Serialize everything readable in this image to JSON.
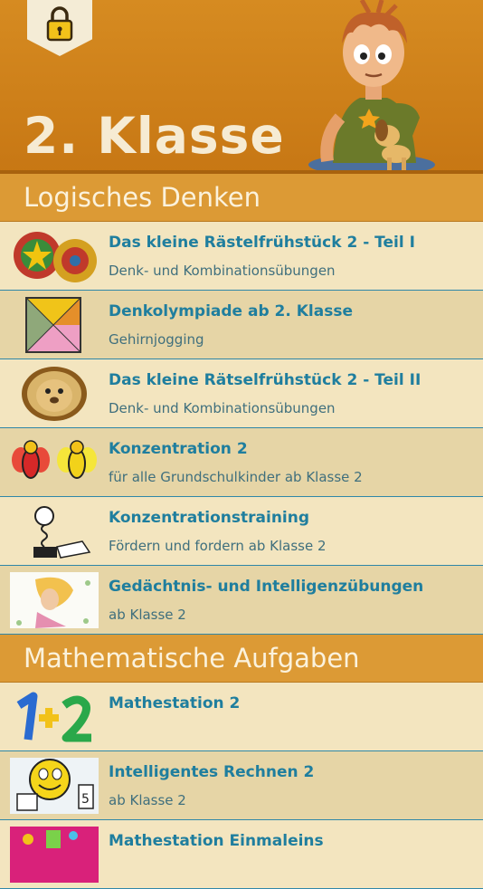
{
  "header": {
    "title": "2. Klasse",
    "lock_icon": "lock-icon"
  },
  "sections": {
    "logic": {
      "title": "Logisches Denken",
      "items": [
        {
          "title": "Das kleine Rästelfrühstück 2 - Teil I",
          "subtitle": "Denk- und Kombinationsübungen"
        },
        {
          "title": "Denkolympiade ab 2. Klasse",
          "subtitle": "Gehirnjogging"
        },
        {
          "title": "Das kleine Rätselfrühstück 2 - Teil II",
          "subtitle": "Denk- und Kombinationsübungen"
        },
        {
          "title": "Konzentration 2",
          "subtitle": "für alle Grundschulkinder ab Klasse 2"
        },
        {
          "title": "Konzentrationstraining",
          "subtitle": "Fördern und fordern ab Klasse 2"
        },
        {
          "title": "Gedächtnis- und Intelligenzübungen",
          "subtitle": "ab Klasse 2"
        }
      ]
    },
    "math": {
      "title": "Mathematische Aufgaben",
      "items": [
        {
          "title": "Mathestation 2",
          "subtitle": ""
        },
        {
          "title": "Intelligentes Rechnen 2",
          "subtitle": "ab Klasse 2"
        },
        {
          "title": "Mathestation Einmaleins",
          "subtitle": ""
        }
      ]
    }
  },
  "colors": {
    "header": "#d68b21",
    "section": "#dc9a35",
    "title_text": "#1f7e9e",
    "row_light": "#f3e5bf",
    "row_dark": "#e6d5a6"
  }
}
